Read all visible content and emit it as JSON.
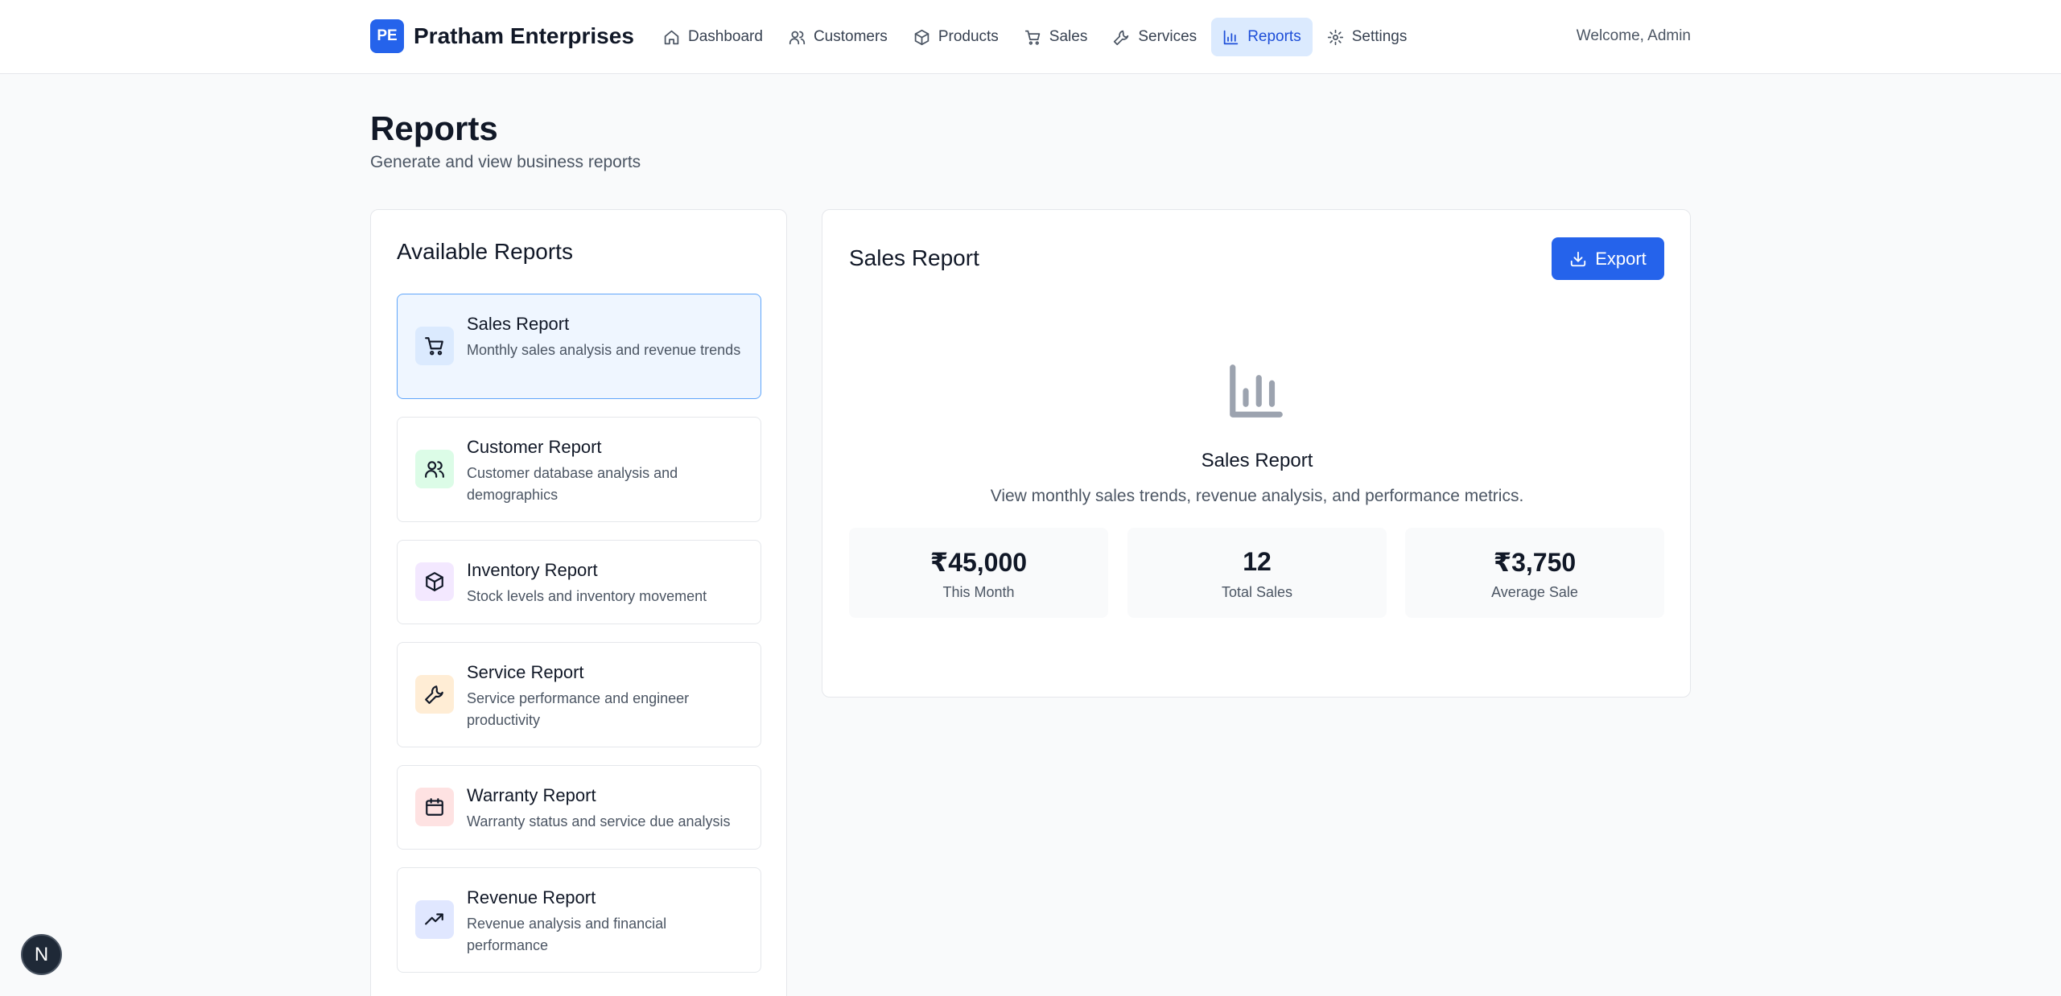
{
  "header": {
    "brand_badge": "PE",
    "brand_name": "Pratham Enterprises",
    "welcome": "Welcome, Admin",
    "nav": [
      {
        "label": "Dashboard",
        "icon": "home-icon"
      },
      {
        "label": "Customers",
        "icon": "users-icon"
      },
      {
        "label": "Products",
        "icon": "package-icon"
      },
      {
        "label": "Sales",
        "icon": "cart-icon"
      },
      {
        "label": "Services",
        "icon": "wrench-icon"
      },
      {
        "label": "Reports",
        "icon": "bar-chart-icon",
        "active": true
      },
      {
        "label": "Settings",
        "icon": "gear-icon"
      }
    ]
  },
  "page": {
    "title": "Reports",
    "subtitle": "Generate and view business reports"
  },
  "available_reports": {
    "title": "Available Reports",
    "items": [
      {
        "title": "Sales Report",
        "description": "Monthly sales analysis and revenue trends",
        "icon": "cart-icon",
        "icon_bg": "#dbeafe",
        "active": true
      },
      {
        "title": "Customer Report",
        "description": "Customer database analysis and demographics",
        "icon": "users-icon",
        "icon_bg": "#dcfce7"
      },
      {
        "title": "Inventory Report",
        "description": "Stock levels and inventory movement",
        "icon": "package-icon",
        "icon_bg": "#f3e8ff"
      },
      {
        "title": "Service Report",
        "description": "Service performance and engineer productivity",
        "icon": "wrench-icon",
        "icon_bg": "#ffedd5"
      },
      {
        "title": "Warranty Report",
        "description": "Warranty status and service due analysis",
        "icon": "calendar-icon",
        "icon_bg": "#fee2e2"
      },
      {
        "title": "Revenue Report",
        "description": "Revenue analysis and financial performance",
        "icon": "trending-up-icon",
        "icon_bg": "#e0e7ff"
      }
    ]
  },
  "detail": {
    "title": "Sales Report",
    "export_label": "Export",
    "center_title": "Sales Report",
    "center_description": "View monthly sales trends, revenue analysis, and performance metrics.",
    "stats": [
      {
        "value": "₹45,000",
        "label": "This Month"
      },
      {
        "value": "12",
        "label": "Total Sales"
      },
      {
        "value": "₹3,750",
        "label": "Average Sale"
      }
    ]
  },
  "floating_badge": "N",
  "colors": {
    "primary": "#2563eb",
    "active_nav_bg": "#dbeafe",
    "page_bg": "#f9fafb"
  }
}
